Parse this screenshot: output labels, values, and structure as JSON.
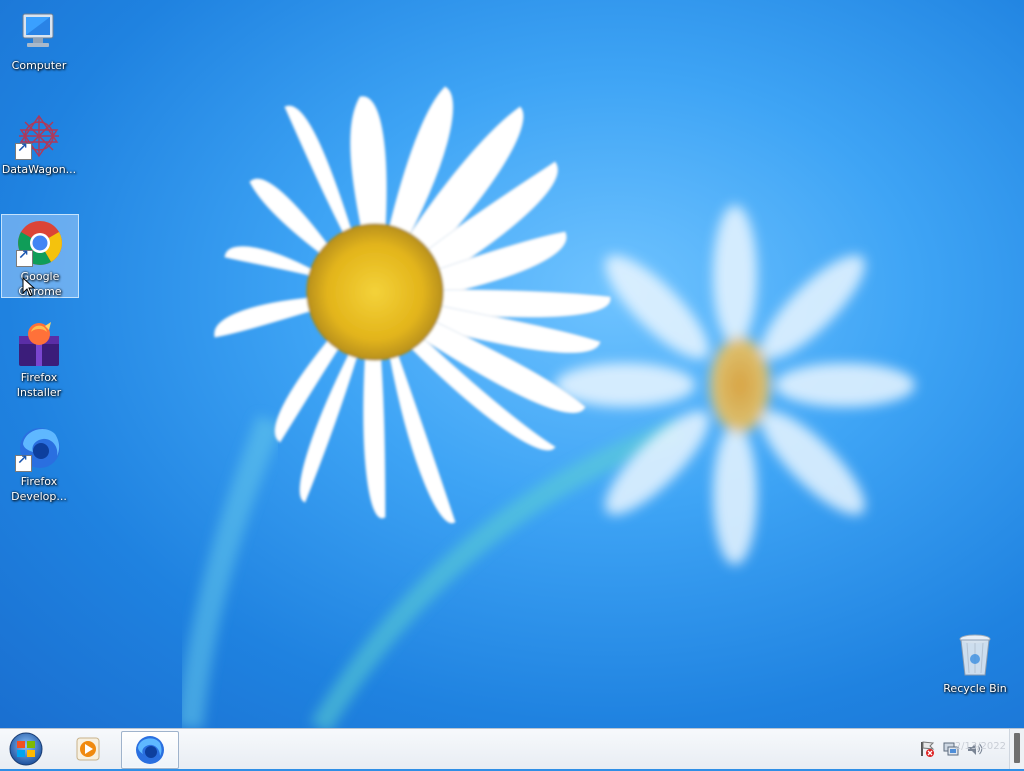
{
  "desktop": {
    "icons": [
      {
        "label": "Computer",
        "icon": "computer-icon",
        "shortcut": false
      },
      {
        "label": "DataWagon...",
        "icon": "datawagon-icon",
        "shortcut": true
      },
      {
        "label": "Google Chrome",
        "icon": "chrome-icon",
        "shortcut": true,
        "selected": true
      },
      {
        "label": "Firefox Installer",
        "icon": "firefox-installer-icon",
        "shortcut": false
      },
      {
        "label": "Firefox Develop...",
        "icon": "firefox-developer-icon",
        "shortcut": true
      },
      {
        "label": "Recycle Bin",
        "icon": "recycle-bin-icon",
        "shortcut": false
      }
    ]
  },
  "taskbar": {
    "start_icon": "windows-start-icon",
    "pinned": [
      {
        "name": "media-player-icon"
      },
      {
        "name": "firefox-taskbar-icon",
        "active": true
      }
    ],
    "tray": [
      "action-center-flag-icon",
      "network-icon",
      "volume-icon"
    ],
    "clock": "2/13/2022"
  },
  "colors": {
    "sky": "#2f8fe6",
    "taskbar": "#f1f4f8",
    "selection": "#bcdcff"
  }
}
